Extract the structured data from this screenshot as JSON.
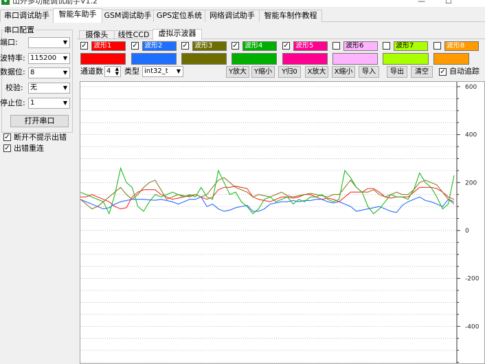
{
  "window": {
    "title": "山外多功能调试助手V1.2",
    "minimize": "—",
    "maximize": "☐"
  },
  "main_tabs": [
    "串口调试助手",
    "智能车助手",
    "GSM调试助手",
    "GPS定位系统",
    "网络调试助手",
    "智能车制作教程"
  ],
  "serial": {
    "legend": "串口配置",
    "port_label": "端口:",
    "port_value": "",
    "baud_label": "波特率:",
    "baud_value": "115200",
    "databits_label": "数据位:",
    "databits_value": "8",
    "parity_label": "校验:",
    "parity_value": "无",
    "stopbits_label": "停止位:",
    "stopbits_value": "1",
    "open_button": "打开串口",
    "no_error_prompt": "断开不提示出错",
    "reconnect": "出错重连"
  },
  "sub_tabs": [
    "摄像头",
    "线性CCD",
    "虚拟示波器"
  ],
  "waveforms": [
    {
      "name": "波形1",
      "color": "#ff0000",
      "checked": true
    },
    {
      "name": "波形2",
      "color": "#1f6fff",
      "checked": true
    },
    {
      "name": "波形3",
      "color": "#6e6e00",
      "checked": true
    },
    {
      "name": "波形4",
      "color": "#00b000",
      "checked": true
    },
    {
      "name": "波形5",
      "color": "#ff0090",
      "checked": true
    },
    {
      "name": "波形6",
      "color": "#ffb4ff",
      "checked": false
    },
    {
      "name": "波形7",
      "color": "#aaff00",
      "checked": false
    },
    {
      "name": "波形8",
      "color": "#ff9a00",
      "checked": false
    }
  ],
  "controls": {
    "channel_label": "通道数",
    "channel_value": "4",
    "type_label": "类型",
    "type_value": "int32_t",
    "y_zoom_in": "Y放大",
    "y_zoom_out": "Y缩小",
    "y_zero": "Y归0",
    "x_zoom_in": "X放大",
    "x_zoom_out": "X缩小",
    "import": "导入",
    "export": "导出",
    "clear": "清空",
    "auto_track": "自动追踪"
  },
  "chart_data": {
    "type": "line",
    "ylim": [
      -560,
      620
    ],
    "yticks": [
      -400,
      -200,
      0,
      200,
      400,
      600
    ],
    "grid": true,
    "series": [
      {
        "color": "#ff2a2a",
        "y": [
          140,
          140,
          150,
          140,
          130,
          120,
          100,
          90,
          95,
          140,
          160,
          170,
          170,
          170,
          150,
          140,
          130,
          135,
          140,
          145,
          150,
          140,
          130,
          140,
          170,
          180,
          180,
          185,
          180,
          175,
          140,
          130,
          125,
          120,
          130,
          140,
          140,
          135,
          140,
          150,
          150,
          140,
          130,
          135,
          130,
          120,
          140,
          160,
          160,
          160,
          175,
          175,
          160,
          140,
          135,
          140,
          140,
          140,
          160,
          180,
          180,
          180,
          175,
          160,
          140,
          130
        ]
      },
      {
        "color": "#2a6aff",
        "y": [
          130,
          120,
          110,
          100,
          90,
          95,
          110,
          120,
          125,
          130,
          130,
          130,
          128,
          126,
          130,
          125,
          120,
          110,
          120,
          130,
          130,
          140,
          100,
          110,
          90,
          80,
          85,
          95,
          100,
          105,
          80,
          80,
          90,
          110,
          115,
          120,
          120,
          125,
          120,
          125,
          125,
          130,
          130,
          120,
          115,
          120,
          110,
          100,
          80,
          85,
          90,
          95,
          100,
          90,
          80,
          75,
          105,
          120,
          130,
          140,
          125,
          120,
          110,
          100,
          130,
          120
        ]
      },
      {
        "color": "#8a7a20",
        "y": [
          130,
          110,
          90,
          100,
          120,
          140,
          160,
          180,
          150,
          130,
          150,
          180,
          200,
          210,
          170,
          130,
          140,
          150,
          145,
          140,
          150,
          140,
          150,
          180,
          210,
          220,
          200,
          180,
          170,
          160,
          140,
          150,
          145,
          140,
          150,
          160,
          145,
          140,
          145,
          150,
          155,
          150,
          145,
          140,
          150,
          150,
          180,
          210,
          180,
          160,
          160,
          170,
          150,
          140,
          150,
          160,
          150,
          150,
          170,
          200,
          210,
          200,
          190,
          160,
          130,
          110
        ]
      },
      {
        "color": "#1eb81e",
        "y": [
          160,
          150,
          140,
          130,
          120,
          70,
          150,
          260,
          200,
          180,
          100,
          80,
          120,
          150,
          140,
          150,
          160,
          150,
          140,
          150,
          140,
          180,
          140,
          130,
          250,
          200,
          150,
          160,
          120,
          100,
          70,
          90,
          130,
          140,
          120,
          130,
          140,
          110,
          130,
          120,
          140,
          140,
          150,
          130,
          120,
          130,
          250,
          220,
          180,
          160,
          100,
          70,
          90,
          120,
          150,
          140,
          140,
          130,
          170,
          240,
          200,
          180,
          140,
          90,
          110,
          230
        ]
      }
    ]
  }
}
